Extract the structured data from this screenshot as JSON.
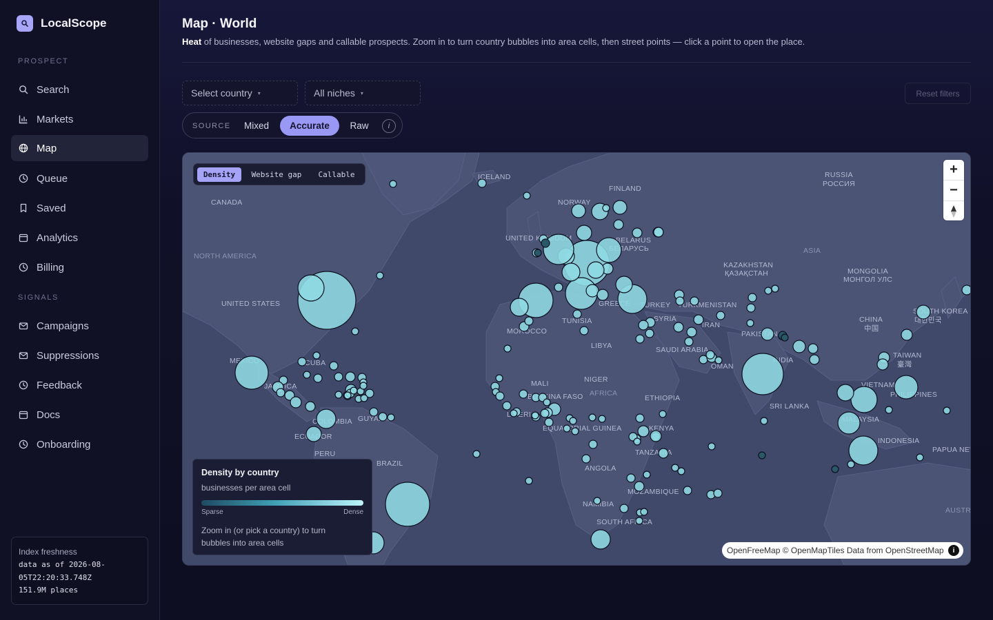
{
  "app": {
    "name": "LocalScope"
  },
  "sidebar": {
    "sections": [
      {
        "label": "PROSPECT"
      },
      {
        "label": "SIGNALS"
      }
    ],
    "items": [
      {
        "label": "Search",
        "icon": "search-icon"
      },
      {
        "label": "Markets",
        "icon": "bar-chart-icon"
      },
      {
        "label": "Map",
        "icon": "globe-icon",
        "active": true
      },
      {
        "label": "Queue",
        "icon": "clock-icon"
      },
      {
        "label": "Saved",
        "icon": "bookmark-icon"
      },
      {
        "label": "Analytics",
        "icon": "calendar-icon"
      },
      {
        "label": "Billing",
        "icon": "clock-icon"
      },
      {
        "label": "Campaigns",
        "icon": "mail-icon"
      },
      {
        "label": "Suppressions",
        "icon": "mail-icon"
      },
      {
        "label": "Feedback",
        "icon": "clock-icon"
      },
      {
        "label": "Docs",
        "icon": "calendar-icon"
      },
      {
        "label": "Onboarding",
        "icon": "clock-icon"
      }
    ],
    "freshness": {
      "title": "Index freshness",
      "line1": "data as of 2026-08-",
      "line2": "05T22:20:33.748Z",
      "line3": "151.9M places"
    }
  },
  "header": {
    "title": "Map · World",
    "desc_bold": "Heat",
    "desc_rest": " of businesses, website gaps and callable prospects. Zoom in to turn country bubbles into area cells, then street points — click a point to open the place."
  },
  "filters": {
    "country": "Select country",
    "niche": "All niches",
    "reset": "Reset filters"
  },
  "source": {
    "label": "SOURCE",
    "options": [
      "Mixed",
      "Accurate",
      "Raw"
    ],
    "selected": "Accurate",
    "info": "i"
  },
  "map": {
    "layers": [
      "Density",
      "Website gap",
      "Callable"
    ],
    "selected_layer": "Density",
    "zoom_in": "+",
    "zoom_out": "−",
    "reset_north": "▲",
    "labels": {
      "iceland": "ICELAND",
      "finland": "FINLAND",
      "russia": "RUSSIA",
      "russia_native": "РОССИЯ",
      "canada": "CANADA",
      "norway": "NORWAY",
      "united_kingdom": "UNITED KINGDOM",
      "belarus": "BELARUS",
      "belarus_native": "БЕЛАРУСЬ",
      "north_america": "NORTH AMERICA",
      "asia": "ASIA",
      "kazakhstan": "KAZAKHSTAN",
      "kazakhstan_native": "ҚАЗАҚСТАН",
      "mongolia": "MONGOLIA",
      "mongolia_native": "МОНГОЛ УЛС",
      "united_states": "UNITED STATES",
      "turkey": "TURKEY",
      "turkmenistan": "TURKMENISTAN",
      "south_korea": "SOUTH KOREA",
      "south_korea_native": "대한민국",
      "greece": "GREECE",
      "tunisia": "TUNISIA",
      "syria": "SYRIA",
      "iran": "IRAN",
      "china": "CHINA",
      "china_native": "中国",
      "morocco": "MOROCCO",
      "pakistan": "PAKISTAN",
      "libya": "LIBYA",
      "saudi_arabia": "SAUDI ARABIA",
      "taiwan": "TAIWAN",
      "taiwan_native": "臺灣",
      "mexico": "MEXICO",
      "cuba": "CUBA",
      "india": "INDIA",
      "oman": "OMAN",
      "jamaica": "JAMAICA",
      "mali": "MALI",
      "niger": "NIGER",
      "vietnam": "VIETNAM",
      "philippines": "PHILIPPINES",
      "burkina_faso": "BURKINA FASO",
      "ethiopia": "ETHIOPIA",
      "sri_lanka": "SRI LANKA",
      "liberia": "LIBERIA",
      "colombia": "COLOMBIA",
      "guyana": "GUYANA",
      "equatorial_guinea": "EQUATORIAL GUINEA",
      "malaysia": "MALAYSIA",
      "ecuador": "ECUADOR",
      "kenya": "KENYA",
      "indonesia": "INDONESIA",
      "peru": "PERU",
      "tanzania": "TANZANIA",
      "papua": "PAPUA NEW GUINEA",
      "brazil": "BRAZIL",
      "angola": "ANGOLA",
      "mozambique": "MOZAMBIQUE",
      "namibia": "NAMIBIA",
      "australia": "AUSTRALIA",
      "south_africa": "SOUTH AFRICA",
      "africa": "AFRICA"
    },
    "legend": {
      "title": "Density by country",
      "subtitle": "businesses per area cell",
      "sparse": "Sparse",
      "dense": "Dense",
      "hint": "Zoom in (or pick a country) to turn bubbles into area cells"
    },
    "attribution": {
      "openfreemap": "OpenFreeMap",
      "copy": "©",
      "openmaptiles": "OpenMapTiles",
      "data_from": "Data from",
      "osm": "OpenStreetMap",
      "info": "i"
    },
    "colors": {
      "bubble_fill": "#8fdbe3",
      "bubble_stroke": "#0c1020",
      "bubble_dark": "#2a5868",
      "ocean": "#41496a",
      "land": "#4a5272"
    }
  }
}
